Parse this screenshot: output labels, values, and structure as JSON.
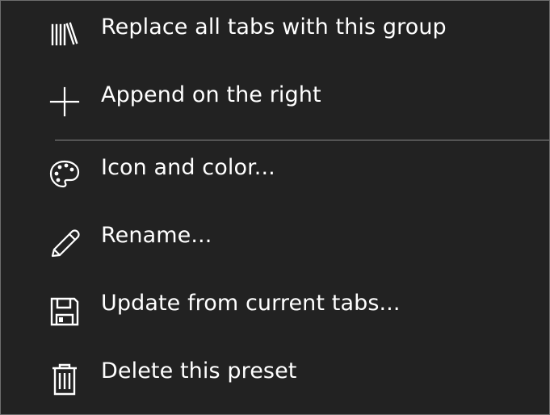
{
  "menu": {
    "items": [
      {
        "id": "replace",
        "label": "Replace all tabs with this group",
        "icon": "library-icon"
      },
      {
        "id": "append",
        "label": "Append on the right",
        "icon": "plus-icon"
      },
      {
        "id": "icon_color",
        "label": "Icon and color...",
        "icon": "palette-icon"
      },
      {
        "id": "rename",
        "label": "Rename...",
        "icon": "pencil-icon"
      },
      {
        "id": "update",
        "label": "Update from current tabs...",
        "icon": "save-icon"
      },
      {
        "id": "delete",
        "label": "Delete this preset",
        "icon": "trash-icon"
      }
    ]
  },
  "colors": {
    "background": "#222222",
    "text": "#ffffff",
    "separator": "#8a8a8a",
    "border": "#6e6e6e"
  }
}
